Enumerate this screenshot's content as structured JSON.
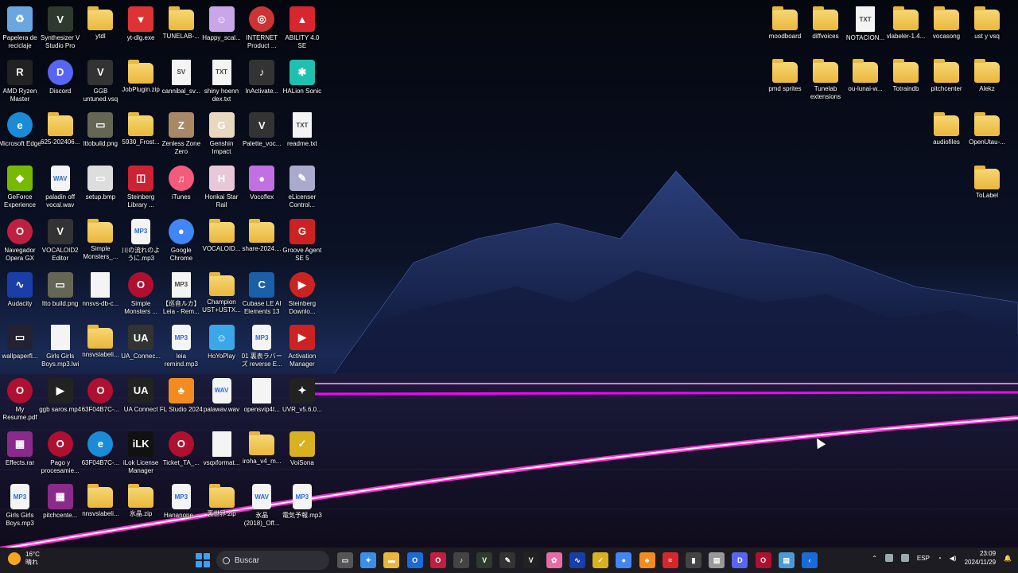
{
  "desktop": {
    "icons": [
      {
        "name": "recycle-bin-icon",
        "label": "Papelera de reciclaje",
        "kind": "app",
        "color": "#6aa6e0",
        "glyph": "♻"
      },
      {
        "name": "synthesizer-v-icon",
        "label": "Synthesizer V Studio Pro",
        "kind": "app",
        "color": "#2d3a2d",
        "glyph": "V"
      },
      {
        "name": "ytdl-folder-icon",
        "label": "ytdl",
        "kind": "folder"
      },
      {
        "name": "yt-dlg-icon",
        "label": "yt-dlg.exe",
        "kind": "app",
        "color": "#d33",
        "glyph": "▼"
      },
      {
        "name": "tunelab-folder-icon",
        "label": "TUNELAB-...",
        "kind": "folder"
      },
      {
        "name": "happy-scale-icon",
        "label": "Happy_scal...",
        "kind": "app",
        "color": "#c9a6e8",
        "glyph": "☺"
      },
      {
        "name": "internet-product-icon",
        "label": "INTERNET Product ...",
        "kind": "app",
        "color": "#c33",
        "glyph": "◎",
        "round": true
      },
      {
        "name": "ability-icon",
        "label": "ABILITY 4.0 SE",
        "kind": "app",
        "color": "#d8262e",
        "glyph": "▲"
      },
      {
        "name": "amd-ryzen-icon",
        "label": "AMD Ryzen Master",
        "kind": "app",
        "color": "#222",
        "glyph": "R"
      },
      {
        "name": "discord-icon",
        "label": "Discord",
        "kind": "app",
        "color": "#5865f2",
        "glyph": "D",
        "round": true
      },
      {
        "name": "ggb-untuned-icon",
        "label": "GGB untuned.vsq",
        "kind": "app",
        "color": "#333",
        "glyph": "V"
      },
      {
        "name": "jobplugin-zip-icon",
        "label": "JobPlugin.zip",
        "kind": "folder"
      },
      {
        "name": "cannibal-icon",
        "label": "cannibal_sv...",
        "kind": "file",
        "glyph": "SV"
      },
      {
        "name": "shiny-hoenn-icon",
        "label": "shiny hoenn dex.txt",
        "kind": "file",
        "glyph": "TXT"
      },
      {
        "name": "inactivate-icon",
        "label": "InActivate...",
        "kind": "app",
        "color": "#333",
        "glyph": "♪"
      },
      {
        "name": "halion-sonic-icon",
        "label": "HALion Sonic",
        "kind": "app",
        "color": "#20c0b0",
        "glyph": "✱"
      },
      {
        "name": "edge-icon",
        "label": "Microsoft Edge",
        "kind": "app",
        "color": "#1a8bd6",
        "glyph": "e",
        "round": true
      },
      {
        "name": "folder-625-icon",
        "label": "625-202406...",
        "kind": "folder"
      },
      {
        "name": "ltto-build-icon",
        "label": "lttobuild.png",
        "kind": "app",
        "color": "#665",
        "glyph": "▭"
      },
      {
        "name": "folder-5930-icon",
        "label": "5930_Frost...",
        "kind": "folder"
      },
      {
        "name": "zenless-icon",
        "label": "Zenless Zone Zero",
        "kind": "app",
        "color": "#aa8866",
        "glyph": "Z"
      },
      {
        "name": "genshin-icon",
        "label": "Genshin Impact",
        "kind": "app",
        "color": "#e8d8c0",
        "glyph": "G"
      },
      {
        "name": "palette-voc-icon",
        "label": "Palette_voc...",
        "kind": "app",
        "color": "#333",
        "glyph": "V"
      },
      {
        "name": "readme-icon",
        "label": "readme.txt",
        "kind": "file",
        "glyph": "TXT"
      },
      {
        "name": "geforce-icon",
        "label": "GeForce Experience",
        "kind": "app",
        "color": "#76b900",
        "glyph": "◆"
      },
      {
        "name": "paladin-wav-icon",
        "label": "paladin off vocal.wav",
        "kind": "audio",
        "glyph": "WAV"
      },
      {
        "name": "setup-bmp-icon",
        "label": "setup.bmp",
        "kind": "app",
        "color": "#ddd",
        "glyph": "▭"
      },
      {
        "name": "steinberg-library-icon",
        "label": "Steinberg Library ...",
        "kind": "app",
        "color": "#c23",
        "glyph": "◫"
      },
      {
        "name": "itunes-icon",
        "label": "iTunes",
        "kind": "app",
        "color": "#f45b7a",
        "glyph": "♫",
        "round": true
      },
      {
        "name": "honkai-icon",
        "label": "Honkai Star Rail",
        "kind": "app",
        "color": "#e8c8d8",
        "glyph": "H"
      },
      {
        "name": "vocoflex-icon",
        "label": "Vocoflex",
        "kind": "app",
        "color": "#c070e0",
        "glyph": "●"
      },
      {
        "name": "elicenser-icon",
        "label": "eLicenser Control...",
        "kind": "app",
        "color": "#aac",
        "glyph": "✎"
      },
      {
        "name": "opera-gx-icon",
        "label": "Navegador Opera GX",
        "kind": "app",
        "color": "#c02040",
        "glyph": "O",
        "round": true
      },
      {
        "name": "vocaloid2-icon",
        "label": "VOCALOID2 Editor",
        "kind": "app",
        "color": "#333",
        "glyph": "V"
      },
      {
        "name": "simple-monsters-folder-icon",
        "label": "Simple Monsters_...",
        "kind": "folder"
      },
      {
        "name": "kawa-mp3-icon",
        "label": "川の流れのように.mp3",
        "kind": "audio",
        "glyph": "MP3"
      },
      {
        "name": "chrome-icon",
        "label": "Google Chrome",
        "kind": "app",
        "color": "#4285f4",
        "glyph": "●",
        "round": true
      },
      {
        "name": "vocaloid-folder-icon",
        "label": "VOCALOID...",
        "kind": "folder"
      },
      {
        "name": "share-2024-icon",
        "label": "share-2024....",
        "kind": "folder"
      },
      {
        "name": "groove-agent-icon",
        "label": "Groove Agent SE 5",
        "kind": "app",
        "color": "#c22",
        "glyph": "G"
      },
      {
        "name": "audacity-icon",
        "label": "Audacity",
        "kind": "app",
        "color": "#1a3ea8",
        "glyph": "∿"
      },
      {
        "name": "ltto-build-png-icon",
        "label": "ltto build.png",
        "kind": "app",
        "color": "#665",
        "glyph": "▭"
      },
      {
        "name": "nnsvs-db-icon",
        "label": "nnsvs-db-c...",
        "kind": "file",
        "glyph": ""
      },
      {
        "name": "simple-monsters-icon",
        "label": "Simple Monsters ...",
        "kind": "app",
        "color": "#b01030",
        "glyph": "O",
        "round": true
      },
      {
        "name": "leia-rem-icon",
        "label": "【巡音ルカ】Leia - Rem...",
        "kind": "file",
        "glyph": "MP3"
      },
      {
        "name": "champion-ust-icon",
        "label": "Champion UST+USTX...",
        "kind": "folder"
      },
      {
        "name": "cubase-icon",
        "label": "Cubase LE AI Elements 13",
        "kind": "app",
        "color": "#1b5fa8",
        "glyph": "C"
      },
      {
        "name": "steinberg-download-icon",
        "label": "Steinberg Downlo...",
        "kind": "app",
        "color": "#c22",
        "glyph": "▶",
        "round": true
      },
      {
        "name": "wallpaper-icon",
        "label": "wallpaperfl...",
        "kind": "app",
        "color": "#223",
        "glyph": "▭"
      },
      {
        "name": "girls-girls-lwi-icon",
        "label": "Girls Girls Boys.mp3.lwi",
        "kind": "file",
        "glyph": ""
      },
      {
        "name": "nnsvslabel-folder-icon",
        "label": "nnsvslabeli...",
        "kind": "folder"
      },
      {
        "name": "ua-connect-shortcut-icon",
        "label": "UA_Connec...",
        "kind": "app",
        "color": "#333",
        "glyph": "UA"
      },
      {
        "name": "leia-remind-icon",
        "label": "leia remind.mp3",
        "kind": "audio",
        "glyph": "MP3"
      },
      {
        "name": "hoyoplay-icon",
        "label": "HoYoPlay",
        "kind": "app",
        "color": "#3aa8e8",
        "glyph": "☺"
      },
      {
        "name": "urahyou-mp3-icon",
        "label": "01 裏表ラバーズ reverse E...",
        "kind": "audio",
        "glyph": "MP3"
      },
      {
        "name": "activation-manager-icon",
        "label": "Activation Manager",
        "kind": "app",
        "color": "#c22",
        "glyph": "▶"
      },
      {
        "name": "my-resume-icon",
        "label": "My Resume.pdf",
        "kind": "app",
        "color": "#b01030",
        "glyph": "O",
        "round": true
      },
      {
        "name": "ggb-saros-icon",
        "label": "ggb saros.mp4",
        "kind": "app",
        "color": "#222",
        "glyph": "▶"
      },
      {
        "name": "63f04b7c-1-icon",
        "label": "63F04B7C-...",
        "kind": "app",
        "color": "#b01030",
        "glyph": "O",
        "round": true
      },
      {
        "name": "ua-connect-icon",
        "label": "UA Connect",
        "kind": "app",
        "color": "#222",
        "glyph": "UA"
      },
      {
        "name": "fl-studio-icon",
        "label": "FL Studio 2024",
        "kind": "app",
        "color": "#f28b20",
        "glyph": "♣"
      },
      {
        "name": "palawav-icon",
        "label": "palawav.wav",
        "kind": "audio",
        "glyph": "WAV"
      },
      {
        "name": "opensvip-icon",
        "label": "opensvip4t...",
        "kind": "file",
        "glyph": ""
      },
      {
        "name": "uvr-icon",
        "label": "UVR_v5.6.0...",
        "kind": "app",
        "color": "#222",
        "glyph": "✦"
      },
      {
        "name": "effects-rar-icon",
        "label": "Effects.rar",
        "kind": "app",
        "color": "#8a2a8a",
        "glyph": "▦"
      },
      {
        "name": "pago-icon",
        "label": "Pago y procesamie...",
        "kind": "app",
        "color": "#b01030",
        "glyph": "O",
        "round": true
      },
      {
        "name": "63f04b7c-2-icon",
        "label": "63F04B7C-...",
        "kind": "app",
        "color": "#1a8bd6",
        "glyph": "e",
        "round": true
      },
      {
        "name": "ilok-icon",
        "label": "iLok License Manager",
        "kind": "app",
        "color": "#111",
        "glyph": "iLK"
      },
      {
        "name": "ticket-icon",
        "label": "Ticket_TA_...",
        "kind": "app",
        "color": "#b01030",
        "glyph": "O",
        "round": true
      },
      {
        "name": "vsqxformat-icon",
        "label": "vsqxformat...",
        "kind": "file",
        "glyph": ""
      },
      {
        "name": "iroha-icon",
        "label": "iroha_v4_m...",
        "kind": "folder"
      },
      {
        "name": "voisona-icon",
        "label": "VoiSona",
        "kind": "app",
        "color": "#d8b020",
        "glyph": "✓"
      },
      {
        "name": "girls-girls-mp3-icon",
        "label": "Girls Girls Boys.mp3",
        "kind": "audio",
        "glyph": "MP3"
      },
      {
        "name": "pitchcenter-rar-icon",
        "label": "pitchcente...",
        "kind": "app",
        "color": "#8a2a8a",
        "glyph": "▦"
      },
      {
        "name": "nnsvslabel-2-icon",
        "label": "nnsvslabeli...",
        "kind": "folder"
      },
      {
        "name": "hyousho-zip-icon",
        "label": "氷晶.zip",
        "kind": "folder"
      },
      {
        "name": "hananone-icon",
        "label": "Hananone...",
        "kind": "audio",
        "glyph": "MP3"
      },
      {
        "name": "urasekai-zip-icon",
        "label": "裏世界.zip",
        "kind": "folder"
      },
      {
        "name": "hyousho-2018-icon",
        "label": "氷晶 (2018)_Off...",
        "kind": "audio",
        "glyph": "WAV"
      },
      {
        "name": "denki-mp3-icon",
        "label": "電気予報.mp3",
        "kind": "audio",
        "glyph": "MP3"
      }
    ],
    "right_icons": [
      {
        "name": "moodboard-folder-icon",
        "label": "moodboard",
        "kind": "folder"
      },
      {
        "name": "diffvoices-folder-icon",
        "label": "diffvoices",
        "kind": "folder"
      },
      {
        "name": "notacion-icon",
        "label": "NOTACION...",
        "kind": "file",
        "glyph": "TXT"
      },
      {
        "name": "vlabeler-folder-icon",
        "label": "vlabeler-1.4...",
        "kind": "folder"
      },
      {
        "name": "vocasong-folder-icon",
        "label": "vocasong",
        "kind": "folder"
      },
      {
        "name": "ust-vsq-folder-icon",
        "label": "ust y vsq",
        "kind": "folder"
      },
      {
        "name": "pmd-sprites-folder-icon",
        "label": "pmd sprites",
        "kind": "folder"
      },
      {
        "name": "tunelab-ext-folder-icon",
        "label": "Tunelab extensions",
        "kind": "folder"
      },
      {
        "name": "ou-lunai-folder-icon",
        "label": "ou-lunai-w...",
        "kind": "folder"
      },
      {
        "name": "totraindb-folder-icon",
        "label": "Totraindb",
        "kind": "folder"
      },
      {
        "name": "pitchcenter-folder-icon",
        "label": "pitchcenter",
        "kind": "folder"
      },
      {
        "name": "alekz-folder-icon",
        "label": "Alekz",
        "kind": "folder"
      },
      {
        "name": "audiofiles-folder-icon",
        "label": "audiofiles",
        "kind": "folder"
      },
      {
        "name": "openutau-folder-icon",
        "label": "OpenUtau-...",
        "kind": "folder"
      },
      {
        "name": "tolabel-folder-icon",
        "label": "ToLabel",
        "kind": "folder"
      }
    ]
  },
  "taskbar": {
    "weather_temp": "16°C",
    "weather_desc": "晴れ",
    "search_placeholder": "Buscar",
    "apps": [
      {
        "name": "task-view-icon",
        "color": "#555",
        "glyph": "▭"
      },
      {
        "name": "copilot-icon",
        "color": "#3a8ee8",
        "glyph": "✦"
      },
      {
        "name": "file-explorer-icon",
        "color": "#e9b73c",
        "glyph": "▬"
      },
      {
        "name": "outlook-icon",
        "color": "#1a6ad8",
        "glyph": "O"
      },
      {
        "name": "opera-taskbar-icon",
        "color": "#c02040",
        "glyph": "O"
      },
      {
        "name": "tunelab-taskbar-icon",
        "color": "#444",
        "glyph": "♪"
      },
      {
        "name": "synthv-taskbar-icon",
        "color": "#2d3a2d",
        "glyph": "V"
      },
      {
        "name": "utau-taskbar-icon",
        "color": "#333",
        "glyph": "✎"
      },
      {
        "name": "vocaloid-taskbar-icon",
        "color": "#222",
        "glyph": "V"
      },
      {
        "name": "paint-taskbar-icon",
        "color": "#e86aa8",
        "glyph": "✿"
      },
      {
        "name": "audacity-taskbar-icon",
        "color": "#1a3ea8",
        "glyph": "∿"
      },
      {
        "name": "voisona-taskbar-icon",
        "color": "#d8b020",
        "glyph": "✓"
      },
      {
        "name": "chrome-taskbar-icon",
        "color": "#4285f4",
        "glyph": "●"
      },
      {
        "name": "fl-taskbar-icon",
        "color": "#f28b20",
        "glyph": "♣"
      },
      {
        "name": "cubase-taskbar-icon",
        "color": "#d8262e",
        "glyph": "≈"
      },
      {
        "name": "film-taskbar-icon",
        "color": "#444",
        "glyph": "▮"
      },
      {
        "name": "notepad-taskbar-icon",
        "color": "#999",
        "glyph": "▤"
      },
      {
        "name": "discord-taskbar-icon",
        "color": "#5865f2",
        "glyph": "D"
      },
      {
        "name": "operagx-taskbar-icon",
        "color": "#b01030",
        "glyph": "O"
      },
      {
        "name": "notes-taskbar-icon",
        "color": "#4a9ad8",
        "glyph": "▤"
      },
      {
        "name": "code-taskbar-icon",
        "color": "#1a6ad8",
        "glyph": "‹"
      }
    ],
    "tray": {
      "language": "ESP",
      "time": "23:09",
      "date": "2024/11/29"
    }
  }
}
